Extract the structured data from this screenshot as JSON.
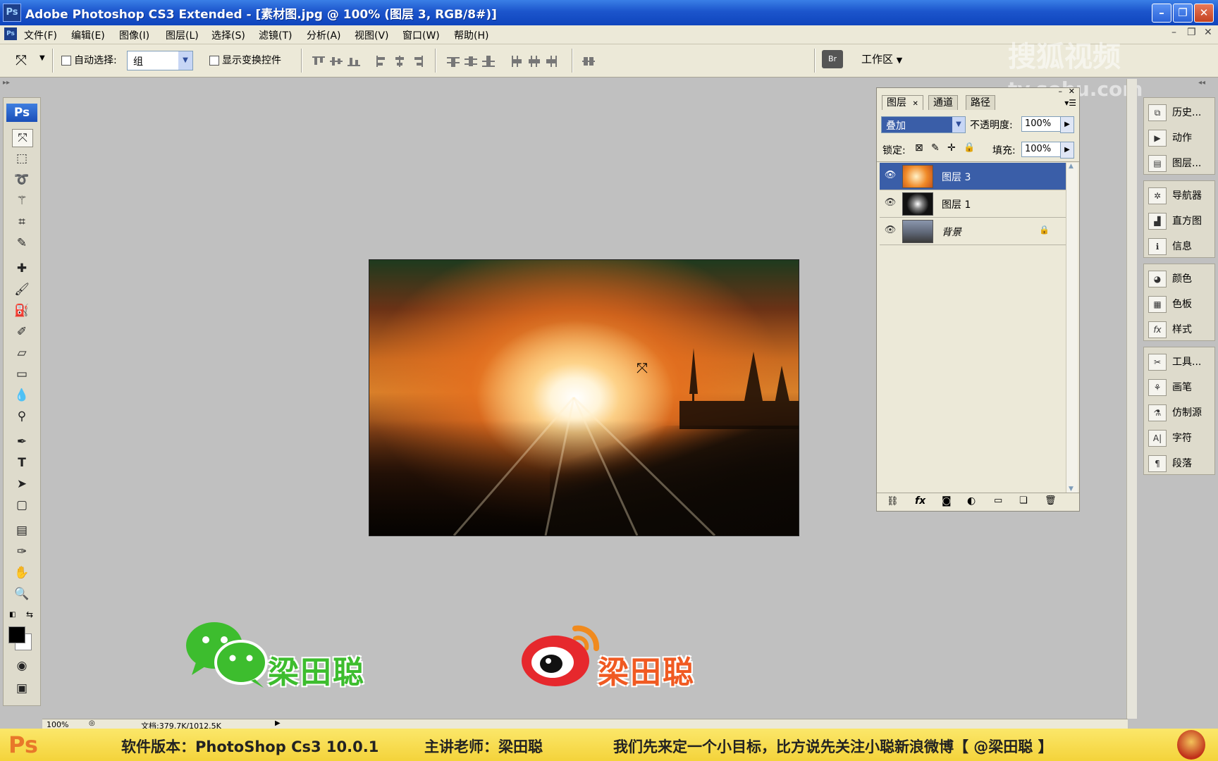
{
  "window": {
    "title": "Adobe Photoshop CS3 Extended - [素材图.jpg @ 100% (图层 3, RGB/8#)]",
    "app_icon": "Ps",
    "controls": [
      "minimize-icon",
      "restore-icon",
      "close-icon"
    ]
  },
  "menu": [
    "文件(F)",
    "编辑(E)",
    "图像(I)",
    "图层(L)",
    "选择(S)",
    "滤镜(T)",
    "分析(A)",
    "视图(V)",
    "窗口(W)",
    "帮助(H)"
  ],
  "options": {
    "auto_select_label": "自动选择:",
    "auto_select_value": "组",
    "transform_controls_label": "显示变换控件",
    "workspace_label": "工作区"
  },
  "watermark": {
    "line1": "搜狐视频",
    "line2": "tv.sohu.com"
  },
  "layers_panel": {
    "tabs": [
      "图层",
      "通道",
      "路径"
    ],
    "blend_mode": "叠加",
    "opacity_label": "不透明度:",
    "opacity": "100%",
    "lock_label": "锁定:",
    "fill_label": "填充:",
    "fill": "100%",
    "layers": [
      {
        "name": "图层 3",
        "selected": true
      },
      {
        "name": "图层 1",
        "selected": false
      },
      {
        "name": "背景",
        "selected": false,
        "locked": true
      }
    ],
    "footer_icons": [
      "link-icon",
      "fx-icon",
      "mask-icon",
      "adjustment-icon",
      "group-icon",
      "new-layer-icon",
      "trash-icon"
    ]
  },
  "dock": [
    [
      "历史...",
      "动作",
      "图层..."
    ],
    [
      "导航器",
      "直方图",
      "信息"
    ],
    [
      "颜色",
      "色板",
      "样式"
    ],
    [
      "工具...",
      "画笔",
      "仿制源",
      "字符",
      "段落"
    ]
  ],
  "status": {
    "zoom": "100%",
    "doc": "文档:379.7K/1012.5K"
  },
  "logos": {
    "wechat_name": "梁田聪",
    "weibo_name": "梁田聪"
  },
  "banner": {
    "logo": "Ps",
    "version": "软件版本：PhotoShop Cs3 10.0.1",
    "teacher": "主讲老师：梁田聪",
    "message": "我们先来定一个小目标，比方说先关注小聪新浪微博【 @梁田聪 】"
  },
  "colors": {
    "titlebar": "#1c55cc",
    "chrome": "#ece9d8",
    "workspace": "#c0c0c0",
    "selection": "#3a5ea8",
    "banner": "#f4d33a",
    "wechat_green": "#3dbd2e",
    "weibo_red": "#e6282d",
    "weibo_orange": "#f08a1e"
  }
}
